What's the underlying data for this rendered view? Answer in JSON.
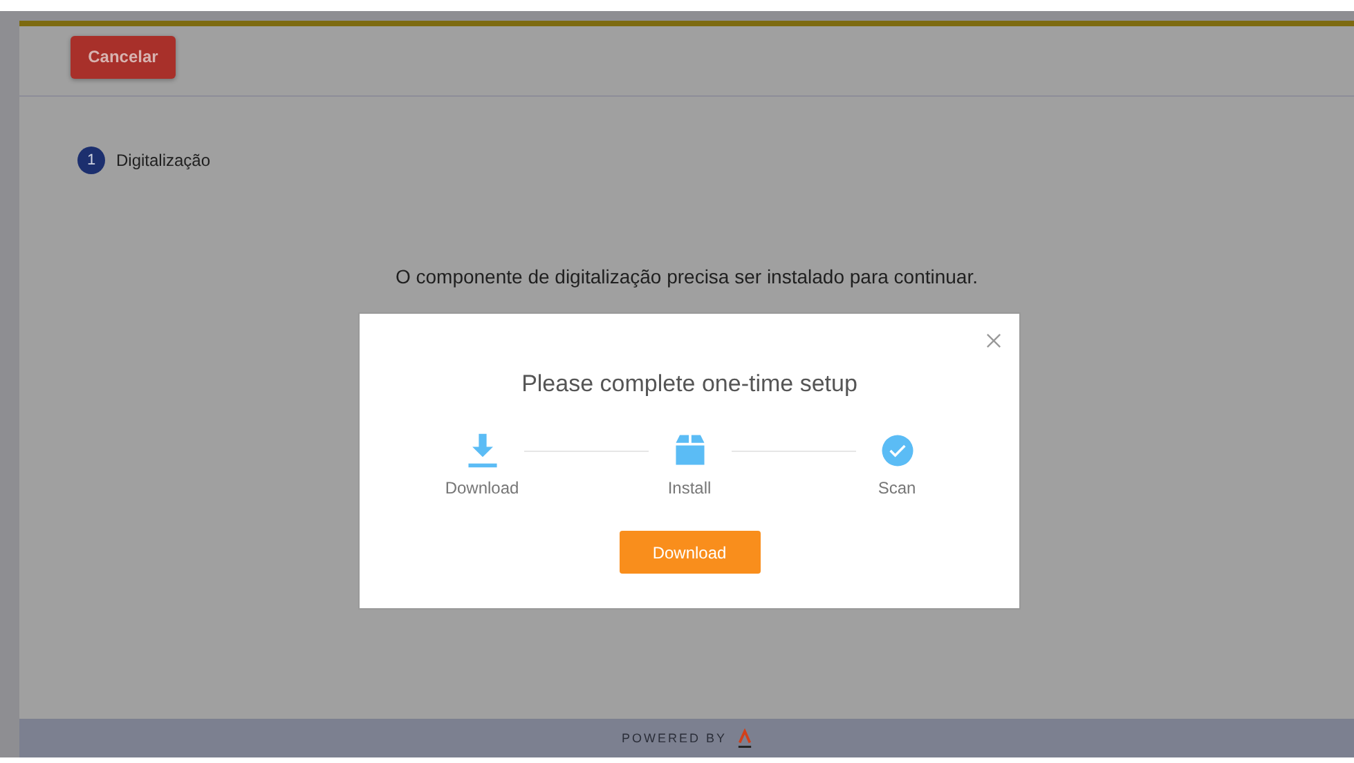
{
  "header": {
    "cancel_button": "Cancelar"
  },
  "stepper": [
    {
      "number": "1",
      "label": "Digitalização"
    }
  ],
  "message": "O componente de digitalização precisa ser instalado para continuar.",
  "modal": {
    "title": "Please complete one-time setup",
    "steps": [
      {
        "kind": "download",
        "label": "Download"
      },
      {
        "kind": "install",
        "label": "Install"
      },
      {
        "kind": "scan",
        "label": "Scan"
      }
    ],
    "button": "Download"
  },
  "footer": {
    "text": "POWERED BY"
  }
}
